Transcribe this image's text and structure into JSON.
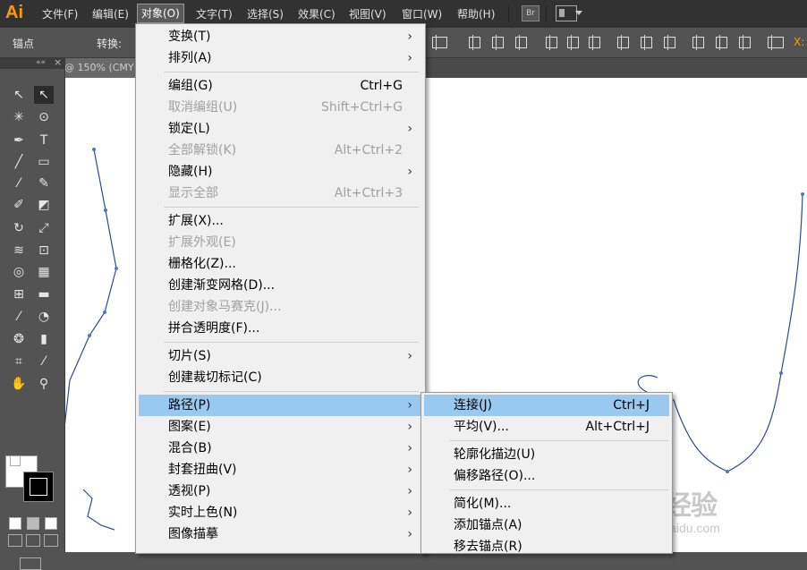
{
  "app": {
    "logo": "Ai",
    "brand_color": "#ff9a00"
  },
  "menubar": {
    "items": [
      "文件(F)",
      "编辑(E)",
      "对象(O)",
      "文字(T)",
      "选择(S)",
      "效果(C)",
      "视图(V)",
      "窗口(W)",
      "帮助(H)"
    ],
    "active_index": 2,
    "bridge_button": "Br"
  },
  "control_bar": {
    "selection_label": "锚点",
    "convert_label": "转换:",
    "x_label": "X:"
  },
  "document_tab": {
    "label": "@ 150% (CMY"
  },
  "tools_panel": {
    "collapse": "««",
    "close": "×"
  },
  "object_menu": {
    "items": [
      {
        "label": "变换(T)",
        "shortcut": "",
        "submenu": true,
        "enabled": true
      },
      {
        "label": "排列(A)",
        "shortcut": "",
        "submenu": true,
        "enabled": true
      },
      {
        "label": "编组(G)",
        "shortcut": "Ctrl+G",
        "submenu": false,
        "enabled": true
      },
      {
        "label": "取消编组(U)",
        "shortcut": "Shift+Ctrl+G",
        "submenu": false,
        "enabled": false
      },
      {
        "label": "锁定(L)",
        "shortcut": "",
        "submenu": true,
        "enabled": true
      },
      {
        "label": "全部解锁(K)",
        "shortcut": "Alt+Ctrl+2",
        "submenu": false,
        "enabled": false
      },
      {
        "label": "隐藏(H)",
        "shortcut": "",
        "submenu": true,
        "enabled": true
      },
      {
        "label": "显示全部",
        "shortcut": "Alt+Ctrl+3",
        "submenu": false,
        "enabled": false
      },
      {
        "label": "扩展(X)...",
        "shortcut": "",
        "submenu": false,
        "enabled": true
      },
      {
        "label": "扩展外观(E)",
        "shortcut": "",
        "submenu": false,
        "enabled": false
      },
      {
        "label": "栅格化(Z)...",
        "shortcut": "",
        "submenu": false,
        "enabled": true
      },
      {
        "label": "创建渐变网格(D)...",
        "shortcut": "",
        "submenu": false,
        "enabled": true
      },
      {
        "label": "创建对象马赛克(J)...",
        "shortcut": "",
        "submenu": false,
        "enabled": false
      },
      {
        "label": "拼合透明度(F)...",
        "shortcut": "",
        "submenu": false,
        "enabled": true
      },
      {
        "label": "切片(S)",
        "shortcut": "",
        "submenu": true,
        "enabled": true
      },
      {
        "label": "创建裁切标记(C)",
        "shortcut": "",
        "submenu": false,
        "enabled": true
      },
      {
        "label": "路径(P)",
        "shortcut": "",
        "submenu": true,
        "enabled": true,
        "highlighted": true
      },
      {
        "label": "图案(E)",
        "shortcut": "",
        "submenu": true,
        "enabled": true
      },
      {
        "label": "混合(B)",
        "shortcut": "",
        "submenu": true,
        "enabled": true
      },
      {
        "label": "封套扭曲(V)",
        "shortcut": "",
        "submenu": true,
        "enabled": true
      },
      {
        "label": "透视(P)",
        "shortcut": "",
        "submenu": true,
        "enabled": true
      },
      {
        "label": "实时上色(N)",
        "shortcut": "",
        "submenu": true,
        "enabled": true
      },
      {
        "label": "图像描摹",
        "shortcut": "",
        "submenu": true,
        "enabled": true
      }
    ]
  },
  "path_submenu": {
    "items": [
      {
        "label": "连接(J)",
        "shortcut": "Ctrl+J",
        "highlighted": true
      },
      {
        "label": "平均(V)...",
        "shortcut": "Alt+Ctrl+J"
      },
      {
        "label": "轮廓化描边(U)",
        "shortcut": ""
      },
      {
        "label": "偏移路径(O)...",
        "shortcut": ""
      },
      {
        "label": "简化(M)...",
        "shortcut": ""
      },
      {
        "label": "添加锚点(A)",
        "shortcut": ""
      },
      {
        "label": "移去锚点(R)",
        "shortcut": ""
      }
    ]
  },
  "watermark": {
    "logo": "Bai 经验",
    "url": "jingyan.baidu.com"
  },
  "icons": [
    "selection-tool-icon",
    "direct-selection-tool-icon",
    "magic-wand-icon",
    "lasso-icon",
    "pen-tool-icon",
    "type-tool-icon",
    "line-tool-icon",
    "rectangle-tool-icon",
    "paintbrush-icon",
    "pencil-icon",
    "rotate-tool-icon",
    "scale-tool-icon",
    "hand-tool-icon",
    "zoom-tool-icon",
    "submenu-arrow-icon"
  ]
}
